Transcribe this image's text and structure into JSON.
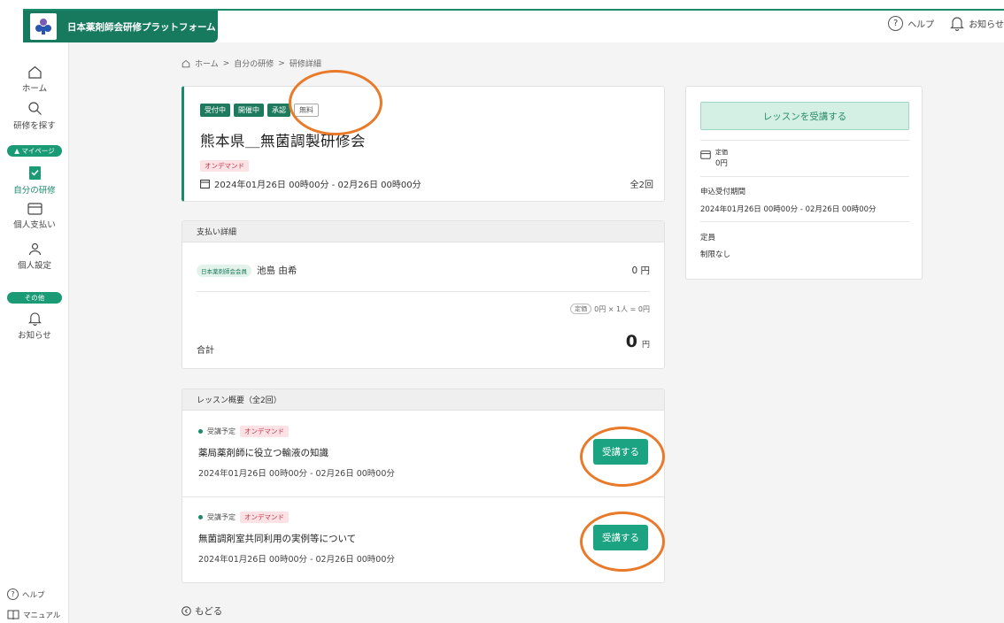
{
  "app": {
    "title": "日本薬剤師会研修プラットフォーム"
  },
  "top": {
    "help": "ヘルプ",
    "notifications": "お知らせ"
  },
  "sidebar": {
    "home": "ホーム",
    "search": "研修を探す",
    "mypage_section": "▲ マイページ",
    "my_training": "自分の研修",
    "payments": "個人支払い",
    "settings": "個人設定",
    "other_section": "その他",
    "notices": "お知らせ",
    "help": "ヘルプ",
    "manual": "マニュアル"
  },
  "breadcrumb": {
    "home": "ホーム",
    "sep": ">",
    "mine": "自分の研修",
    "current": "研修詳細"
  },
  "course": {
    "badges": [
      "受付中",
      "開催中",
      "承認"
    ],
    "free_badge": "無料",
    "title": "熊本県＿無菌調製研修会",
    "type_tag": "オンデマンド",
    "dates": "2024年01月26日 00時00分 - 02月26日 00時00分",
    "count": "全2回"
  },
  "payment": {
    "heading": "支払い詳細",
    "member_tag": "日本薬剤師会会員",
    "member_name": "池島 由希",
    "amount": "0 円",
    "formula_tag": "定価",
    "formula": "0円 × 1人 = 0円",
    "total_label": "合計",
    "total_value": "0",
    "total_unit": "円"
  },
  "lessons": {
    "heading": "レッスン概要（全2回）",
    "items": [
      {
        "status": "受講予定",
        "tag": "オンデマンド",
        "title": "薬局薬剤師に役立つ輸液の知識",
        "dates": "2024年01月26日 00時00分 - 02月26日 00時00分",
        "button": "受講する"
      },
      {
        "status": "受講予定",
        "tag": "オンデマンド",
        "title": "無菌調剤室共同利用の実例等について",
        "dates": "2024年01月26日 00時00分 - 02月26日 00時00分",
        "button": "受講する"
      }
    ]
  },
  "back": "もどる",
  "panel": {
    "button": "レッスンを受講する",
    "price_label": "定価",
    "price_value": "0円",
    "period_label": "申込受付期間",
    "period_value": "2024年01月26日 00時00分 - 02月26日 00時00分",
    "capacity_label": "定員",
    "capacity_value": "制限なし"
  },
  "colors": {
    "brand": "#177a5f",
    "accent": "#1ba382",
    "annotation": "#e87a2a"
  }
}
